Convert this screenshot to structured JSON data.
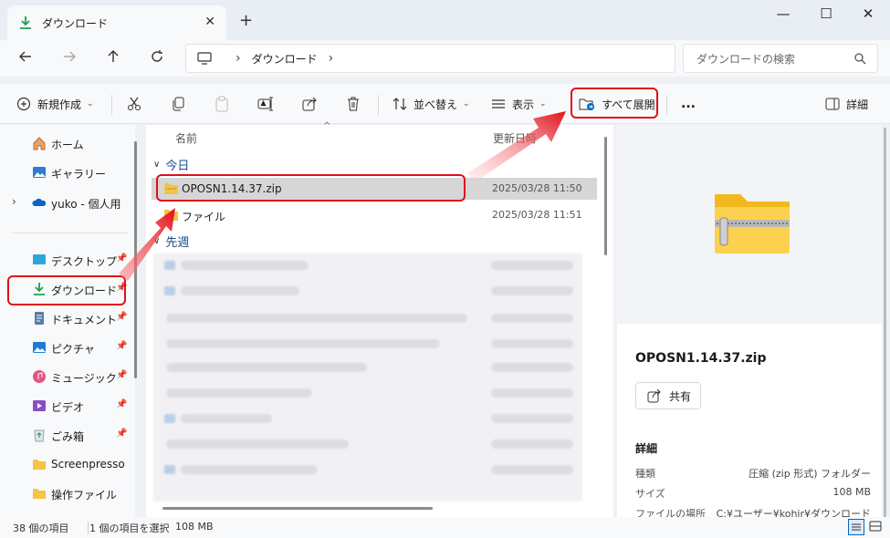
{
  "window": {
    "tab_title": "ダウンロード",
    "close_tab": "✕",
    "new_tab": "+",
    "minimize": "—",
    "maximize": "☐",
    "close": "✕"
  },
  "address": {
    "crumbs": [
      "ダウンロード"
    ],
    "search_placeholder": "ダウンロードの検索"
  },
  "toolbar": {
    "new_label": "新規作成",
    "sort_label": "並べ替え",
    "view_label": "表示",
    "extract_label": "すべて展開",
    "more_label": "...",
    "details_label": "詳細"
  },
  "sidebar": {
    "items": [
      {
        "label": "ホーム",
        "icon": "home-icon"
      },
      {
        "label": "ギャラリー",
        "icon": "gallery-icon"
      },
      {
        "label": "yuko - 個人用",
        "icon": "onedrive-icon"
      },
      {
        "label": "デスクトップ",
        "icon": "desktop-icon"
      },
      {
        "label": "ダウンロード",
        "icon": "download-icon"
      },
      {
        "label": "ドキュメント",
        "icon": "document-icon"
      },
      {
        "label": "ピクチャ",
        "icon": "picture-icon"
      },
      {
        "label": "ミュージック",
        "icon": "music-icon"
      },
      {
        "label": "ビデオ",
        "icon": "video-icon"
      },
      {
        "label": "ごみ箱",
        "icon": "recycle-bin-icon"
      },
      {
        "label": "Screenpresso",
        "icon": "folder-icon"
      },
      {
        "label": "操作ファイル",
        "icon": "folder-icon"
      }
    ]
  },
  "filelist": {
    "col_name": "名前",
    "col_date": "更新日時",
    "groups": [
      {
        "label": "今日",
        "files": [
          {
            "name": "OPOSN1.14.37.zip",
            "date": "2025/03/28 11:50"
          },
          {
            "name": "ファイル",
            "date": "2025/03/28 11:51"
          }
        ]
      },
      {
        "label": "先週",
        "files": []
      }
    ]
  },
  "details": {
    "title": "OPOSN1.14.37.zip",
    "share_label": "共有",
    "section": "詳細",
    "props": [
      {
        "key": "種類",
        "value": "圧縮 (zip 形式) フォルダー"
      },
      {
        "key": "サイズ",
        "value": "108 MB"
      },
      {
        "key": "ファイルの場所",
        "value": "C:¥ユーザー¥kohir¥ダウンロード"
      }
    ]
  },
  "status": {
    "count": "38 個の項目",
    "selection": "1 個の項目を選択",
    "size": "108 MB"
  },
  "colors": {
    "highlight": "#e0101a",
    "accent": "#0067c0"
  }
}
